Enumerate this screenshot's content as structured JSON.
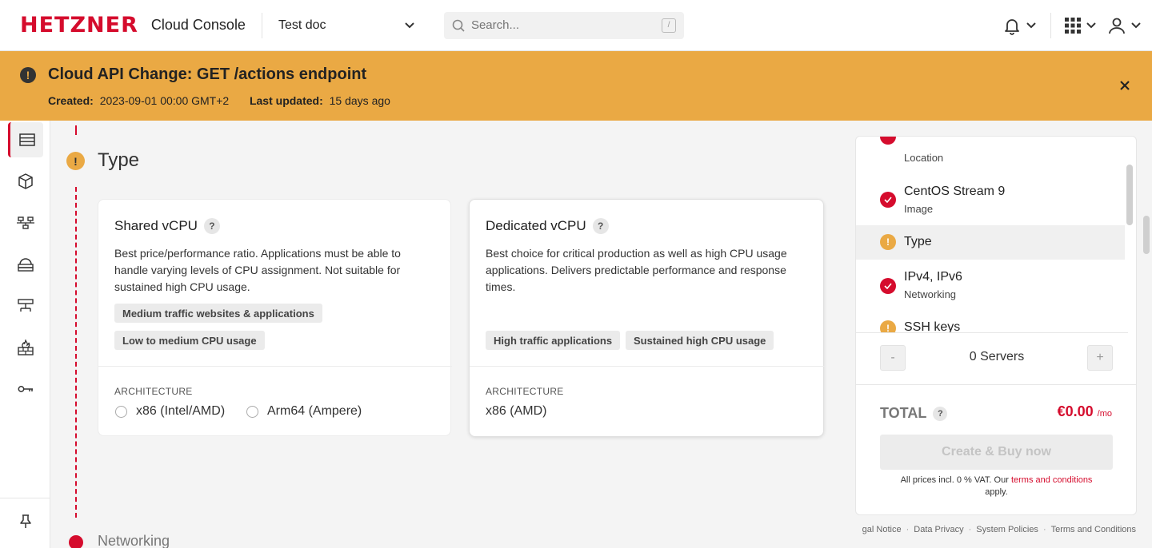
{
  "header": {
    "logo": "HETZNER",
    "app_title": "Cloud Console",
    "project": "Test doc",
    "search_placeholder": "Search...",
    "search_shortcut": "/"
  },
  "banner": {
    "title": "Cloud API Change: GET /actions endpoint",
    "created_label": "Created:",
    "created_value": "2023-09-01 00:00 GMT+2",
    "updated_label": "Last updated:",
    "updated_value": "15 days ago"
  },
  "section": {
    "title": "Type",
    "next_title": "Networking"
  },
  "cards": {
    "shared": {
      "title": "Shared vCPU",
      "help": "?",
      "description": "Best price/performance ratio. Applications must be able to handle varying levels of CPU assignment. Not suitable for sustained high CPU usage.",
      "tags": [
        "Medium traffic websites & applications",
        "Low to medium CPU usage"
      ],
      "arch_label": "ARCHITECTURE",
      "arch_options": [
        "x86 (Intel/AMD)",
        "Arm64 (Ampere)"
      ]
    },
    "dedicated": {
      "title": "Dedicated vCPU",
      "help": "?",
      "description": "Best choice for critical production as well as high CPU usage applications. Delivers predictable performance and response times.",
      "tags": [
        "High traffic applications",
        "Sustained high CPU usage"
      ],
      "arch_label": "ARCHITECTURE",
      "arch_value": "x86 (AMD)"
    }
  },
  "summary": {
    "steps": [
      {
        "title": "",
        "sub": "Location",
        "status": "ok"
      },
      {
        "title": "CentOS Stream 9",
        "sub": "Image",
        "status": "ok"
      },
      {
        "title": "Type",
        "sub": "",
        "status": "warn"
      },
      {
        "title": "IPv4, IPv6",
        "sub": "Networking",
        "status": "ok"
      },
      {
        "title": "SSH keys",
        "sub": "",
        "status": "warn"
      }
    ],
    "minus": "-",
    "plus": "+",
    "servers": "0 Servers",
    "total_label": "TOTAL",
    "total_help": "?",
    "total_price": "€0.00",
    "per_month": "/mo",
    "buy_label": "Create & Buy now",
    "vat_text": "All prices incl. 0 % VAT. Our",
    "vat_link": "terms and conditions",
    "vat_end": "apply."
  },
  "footer": {
    "links": [
      "gal Notice",
      "Data Privacy",
      "System Policies",
      "Terms and Conditions"
    ]
  },
  "colors": {
    "brand": "#d50c2d",
    "warning": "#eaa944"
  }
}
